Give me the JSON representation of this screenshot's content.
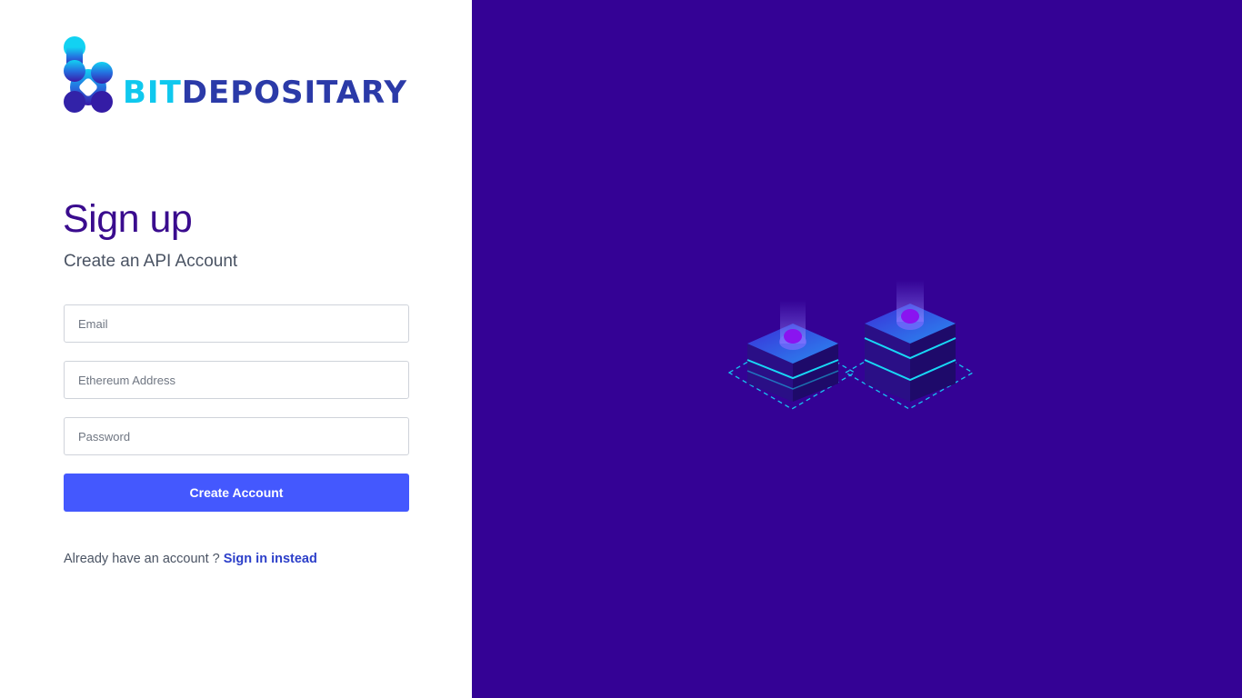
{
  "brand": {
    "name_part1": "BIT",
    "name_part2": "DEPOSITARY",
    "colors": {
      "accent_cyan": "#0fc8ee",
      "brand_blue": "#2b3aa8",
      "title_purple": "#3a0c8e",
      "button_blue": "#4458fe",
      "panel_purple": "#340295"
    }
  },
  "form": {
    "title": "Sign up",
    "subtitle": "Create an API Account",
    "email": {
      "placeholder": "Email",
      "value": ""
    },
    "ethereum_address": {
      "placeholder": "Ethereum Address",
      "value": ""
    },
    "password": {
      "placeholder": "Password",
      "value": ""
    },
    "submit_label": "Create Account"
  },
  "footer": {
    "prompt": "Already have an account ? ",
    "link_label": "Sign in instead"
  },
  "illustration": {
    "icon": "blockchain-servers-icon"
  }
}
